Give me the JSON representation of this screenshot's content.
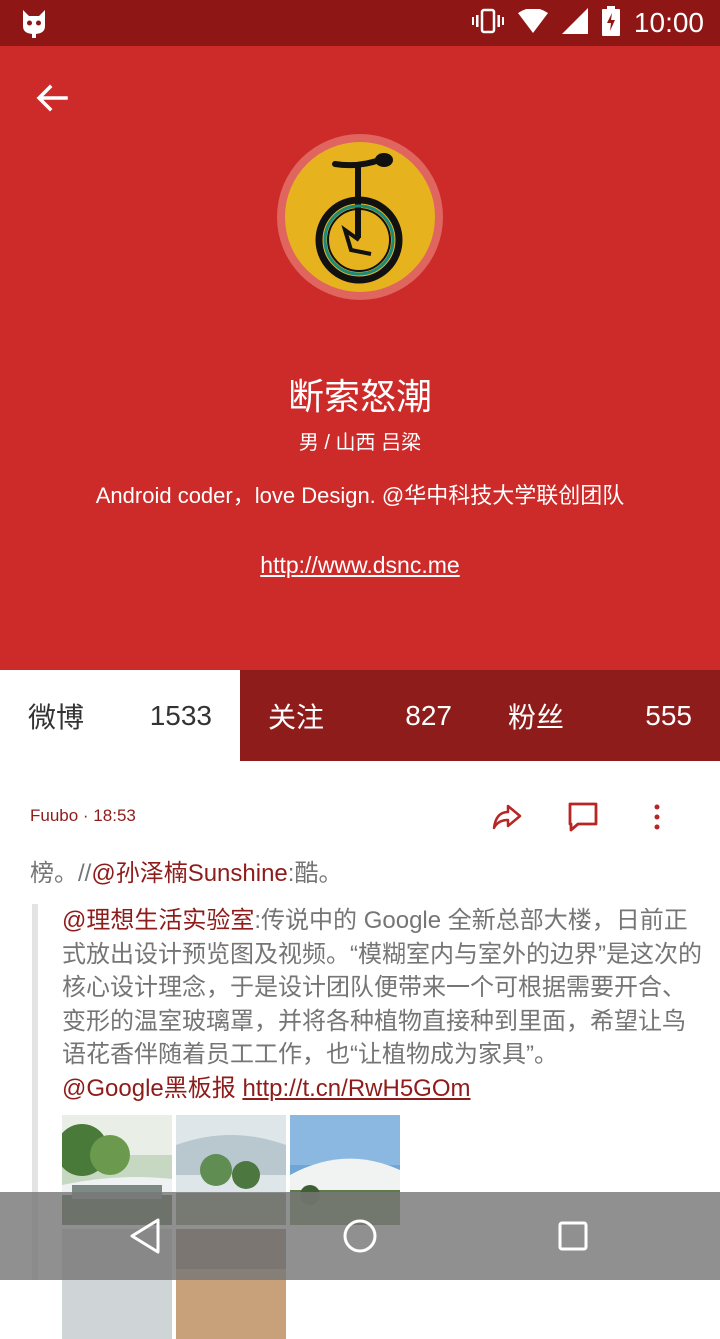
{
  "status_bar": {
    "time": "10:00"
  },
  "profile": {
    "name": "断索怒潮",
    "meta": "男 / 山西 吕梁",
    "bio": "Android coder，love Design.  @华中科技大学联创团队",
    "link": "http://www.dsnc.me"
  },
  "tabs": [
    {
      "label": "微博",
      "count": "1533"
    },
    {
      "label": "关注",
      "count": "827"
    },
    {
      "label": "粉丝",
      "count": "555"
    }
  ],
  "post": {
    "author": "Fuubo · 18:53",
    "body_prefix": "榜。//",
    "body_mention": "@孙泽楠Sunshine",
    "body_suffix": ":酷。",
    "quote_mention": "@理想生活实验室",
    "quote_text": ":传说中的 Google 全新总部大楼，日前正式放出设计预览图及视频。“模糊室内与室外的边界”是这次的核心设计理念，于是设计团队便带来一个可根据需要开合、变形的温室玻璃罩，并将各种植物直接种到里面，希望让鸟语花香伴随着员工工作，也“让植物成为家具”。",
    "quote_mention2": "@Google黑板报",
    "quote_url": "http://t.cn/RwH5GOm"
  },
  "icons": {
    "status_left": "cat-icon",
    "vibrate": "vibrate-icon",
    "wifi": "wifi-icon",
    "signal": "signal-icon",
    "battery": "battery-icon",
    "back": "back-arrow-icon",
    "repost": "share-icon",
    "comment": "comment-icon",
    "more": "more-vert-icon",
    "nav_back": "nav-back-icon",
    "nav_home": "nav-home-icon",
    "nav_recents": "nav-recents-icon"
  },
  "colors": {
    "header": "#cc2b29",
    "statusbar": "#8e1716",
    "accent": "#8e1c1a",
    "avatar": "#e6b31f"
  }
}
